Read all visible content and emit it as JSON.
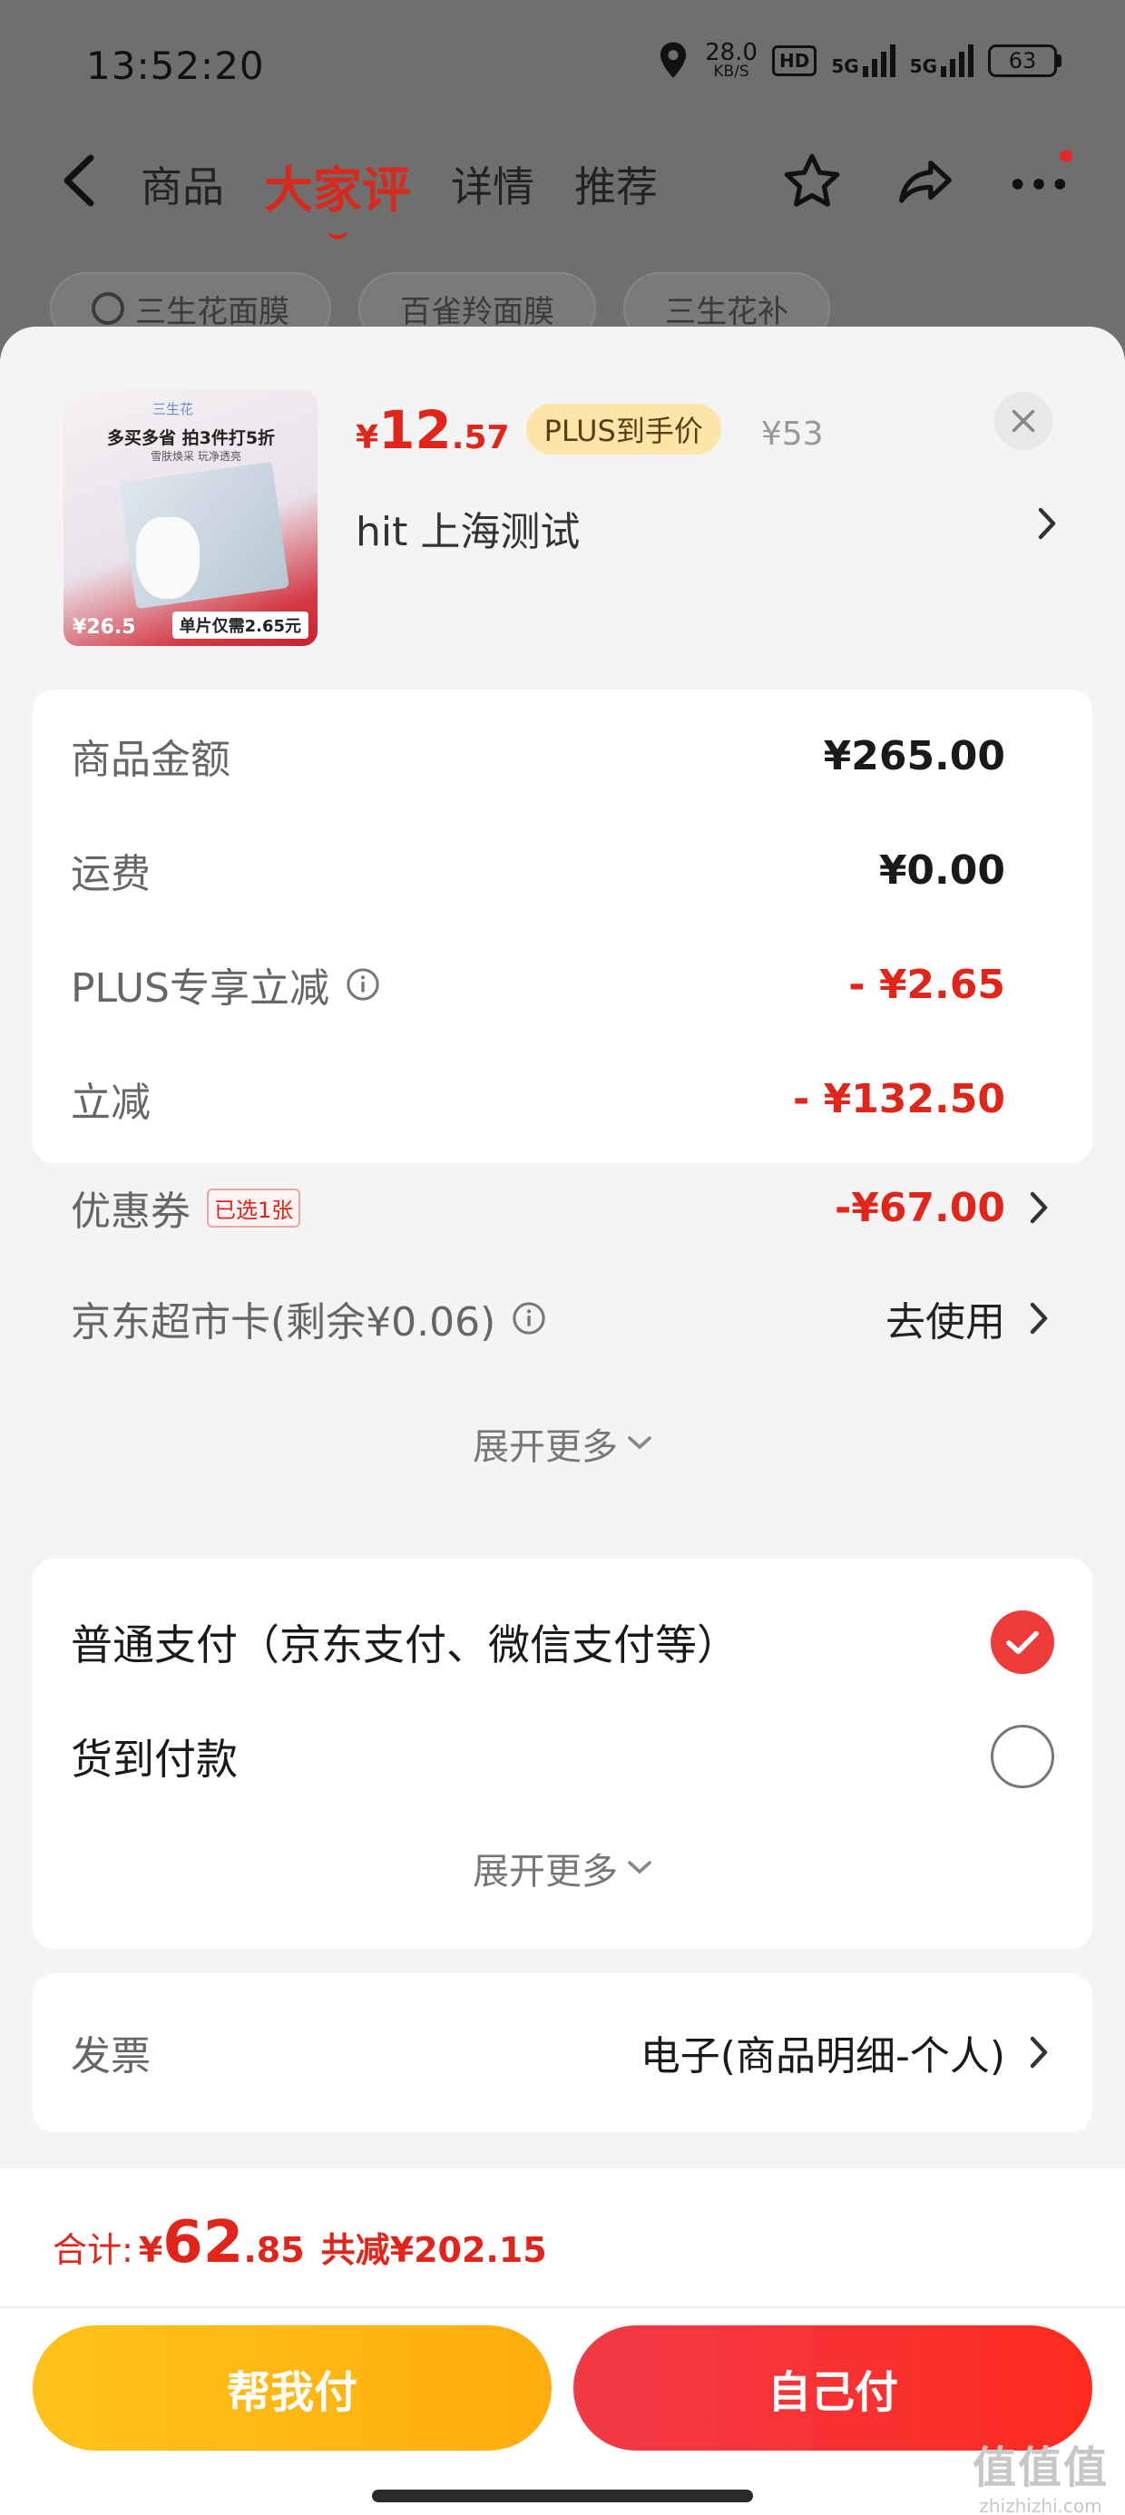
{
  "status_bar": {
    "time": "13:52:20",
    "speed_value": "28.0",
    "speed_unit": "KB/S",
    "hd_label": "HD",
    "net1": "5G",
    "net2": "5G",
    "battery": "63"
  },
  "nav": {
    "tabs": [
      {
        "label": "商品",
        "active": false
      },
      {
        "label": "大家评",
        "active": true
      },
      {
        "label": "详情",
        "active": false
      },
      {
        "label": "推荐",
        "active": false
      }
    ]
  },
  "chips": [
    "三生花面膜",
    "百雀羚面膜",
    "三生花补"
  ],
  "product": {
    "price_symbol": "¥",
    "price_int": "12",
    "price_dec": ".57",
    "plus_badge": "PLUS到手价",
    "original_price": "¥53",
    "address": "hit  上海测试",
    "thumb": {
      "brand": "三生花",
      "promo": "多买多省 拍3件打5折",
      "promo_sub": "雪肤焕采 玩净透亮",
      "price": "¥26.5",
      "note": "单片仅需2.65元"
    }
  },
  "summary": {
    "rows": [
      {
        "label": "商品金额",
        "value": "¥265.00"
      },
      {
        "label": "运费",
        "value": "¥0.00"
      },
      {
        "label": "PLUS专享立减",
        "value": "- ¥2.65"
      },
      {
        "label": "立减",
        "value": "- ¥132.50"
      },
      {
        "label": "优惠券",
        "tag": "已选1张",
        "value": "-¥67.00"
      },
      {
        "label": "京东超市卡(剩余¥0.06)",
        "value": "去使用"
      }
    ],
    "expand_label": "展开更多"
  },
  "payment": {
    "options": [
      {
        "label": "普通支付（京东支付、微信支付等）",
        "checked": true
      },
      {
        "label": "货到付款",
        "checked": false
      }
    ],
    "expand_label": "展开更多"
  },
  "invoice": {
    "label": "发票",
    "value": "电子(商品明细-个人)"
  },
  "footer": {
    "total_label": "合计:",
    "total_symbol": "¥",
    "total_int": "62",
    "total_dec": ".85",
    "saved": "共减¥202.15",
    "help_pay": "帮我付",
    "self_pay": "自己付"
  },
  "watermark": {
    "logo": "值值值",
    "url": "zhizhizhi.com"
  },
  "colors": {
    "accent_red": "#e1251b",
    "plus_gold": "#fde4a7",
    "help_yellow": "#ffb814"
  }
}
